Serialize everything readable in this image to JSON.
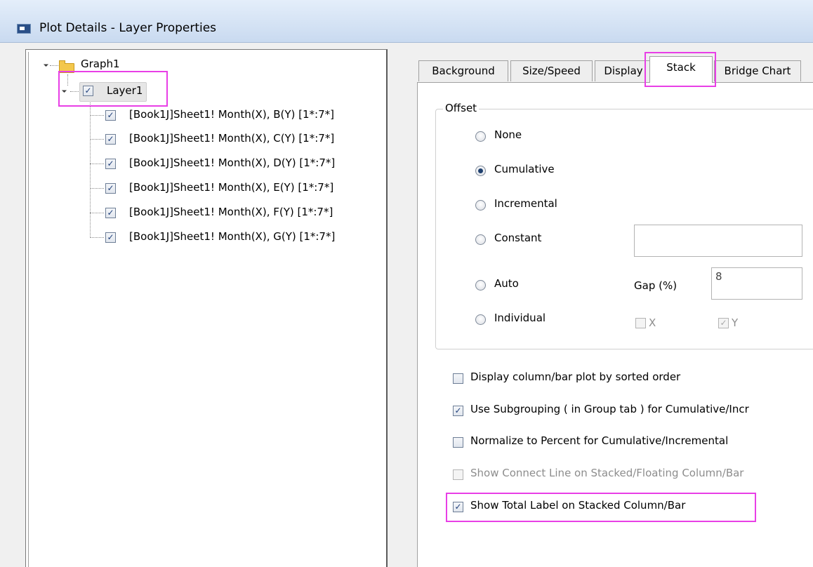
{
  "window": {
    "title": "Plot Details - Layer Properties"
  },
  "tree": {
    "root_label": "Graph1",
    "layer_label": "Layer1",
    "layer_checked": true,
    "items": [
      {
        "label": "[Book1J]Sheet1! Month(X), B(Y) [1*:7*]",
        "checked": true
      },
      {
        "label": "[Book1J]Sheet1! Month(X), C(Y) [1*:7*]",
        "checked": true
      },
      {
        "label": "[Book1J]Sheet1! Month(X), D(Y) [1*:7*]",
        "checked": true
      },
      {
        "label": "[Book1J]Sheet1! Month(X), E(Y) [1*:7*]",
        "checked": true
      },
      {
        "label": "[Book1J]Sheet1! Month(X), F(Y) [1*:7*]",
        "checked": true
      },
      {
        "label": "[Book1J]Sheet1! Month(X), G(Y) [1*:7*]",
        "checked": true
      }
    ]
  },
  "tabs": [
    {
      "label": "Background"
    },
    {
      "label": "Size/Speed"
    },
    {
      "label": "Display"
    },
    {
      "label": "Stack",
      "active": true
    },
    {
      "label": "Bridge Chart"
    }
  ],
  "stack": {
    "offset_group_title": "Offset",
    "offset_options": [
      {
        "label": "None",
        "selected": false
      },
      {
        "label": "Cumulative",
        "selected": true
      },
      {
        "label": "Incremental",
        "selected": false
      },
      {
        "label": "Constant",
        "selected": false
      },
      {
        "label": "Auto",
        "selected": false
      },
      {
        "label": "Individual",
        "selected": false
      }
    ],
    "constant_value": "",
    "gap_label": "Gap (%)",
    "gap_value": "8",
    "individual_x_label": "X",
    "individual_x_checked": false,
    "individual_y_label": "Y",
    "individual_y_checked": true,
    "checkboxes": [
      {
        "label": "Display column/bar plot by sorted order",
        "checked": false,
        "enabled": true
      },
      {
        "label": "Use Subgrouping ( in Group tab ) for Cumulative/Incr",
        "checked": true,
        "enabled": true
      },
      {
        "label": "Normalize to Percent for Cumulative/Incremental",
        "checked": false,
        "enabled": true
      },
      {
        "label": "Show Connect Line on Stacked/Floating Column/Bar",
        "checked": false,
        "enabled": false
      },
      {
        "label": "Show Total Label on Stacked Column/Bar",
        "checked": true,
        "enabled": true
      }
    ]
  },
  "colors": {
    "highlight_box": "#e83fe6",
    "titlebar": "#c9daf0"
  }
}
